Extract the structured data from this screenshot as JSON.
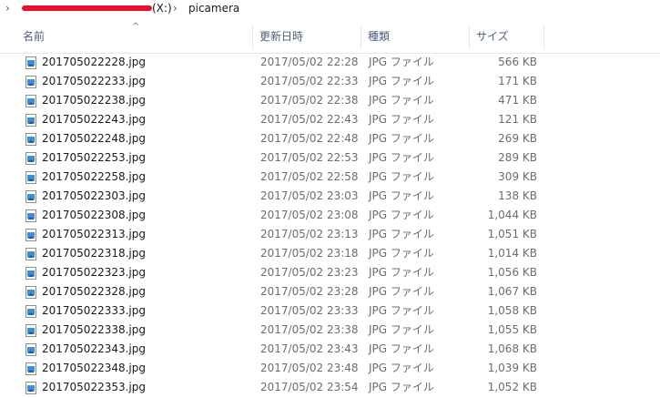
{
  "breadcrumb": {
    "drive": "(X:)",
    "separator": "›",
    "folder": "picamera"
  },
  "columns": {
    "name": "名前",
    "date": "更新日時",
    "type": "種類",
    "size": "サイズ"
  },
  "sort_indicator": "^",
  "files": [
    {
      "name": "201705022228.jpg",
      "date": "2017/05/02 22:28",
      "type": "JPG ファイル",
      "size": "566 KB"
    },
    {
      "name": "201705022233.jpg",
      "date": "2017/05/02 22:33",
      "type": "JPG ファイル",
      "size": "171 KB"
    },
    {
      "name": "201705022238.jpg",
      "date": "2017/05/02 22:38",
      "type": "JPG ファイル",
      "size": "471 KB"
    },
    {
      "name": "201705022243.jpg",
      "date": "2017/05/02 22:43",
      "type": "JPG ファイル",
      "size": "121 KB"
    },
    {
      "name": "201705022248.jpg",
      "date": "2017/05/02 22:48",
      "type": "JPG ファイル",
      "size": "269 KB"
    },
    {
      "name": "201705022253.jpg",
      "date": "2017/05/02 22:53",
      "type": "JPG ファイル",
      "size": "289 KB"
    },
    {
      "name": "201705022258.jpg",
      "date": "2017/05/02 22:58",
      "type": "JPG ファイル",
      "size": "309 KB"
    },
    {
      "name": "201705022303.jpg",
      "date": "2017/05/02 23:03",
      "type": "JPG ファイル",
      "size": "138 KB"
    },
    {
      "name": "201705022308.jpg",
      "date": "2017/05/02 23:08",
      "type": "JPG ファイル",
      "size": "1,044 KB"
    },
    {
      "name": "201705022313.jpg",
      "date": "2017/05/02 23:13",
      "type": "JPG ファイル",
      "size": "1,051 KB"
    },
    {
      "name": "201705022318.jpg",
      "date": "2017/05/02 23:18",
      "type": "JPG ファイル",
      "size": "1,014 KB"
    },
    {
      "name": "201705022323.jpg",
      "date": "2017/05/02 23:23",
      "type": "JPG ファイル",
      "size": "1,056 KB"
    },
    {
      "name": "201705022328.jpg",
      "date": "2017/05/02 23:28",
      "type": "JPG ファイル",
      "size": "1,067 KB"
    },
    {
      "name": "201705022333.jpg",
      "date": "2017/05/02 23:33",
      "type": "JPG ファイル",
      "size": "1,058 KB"
    },
    {
      "name": "201705022338.jpg",
      "date": "2017/05/02 23:38",
      "type": "JPG ファイル",
      "size": "1,055 KB"
    },
    {
      "name": "201705022343.jpg",
      "date": "2017/05/02 23:43",
      "type": "JPG ファイル",
      "size": "1,068 KB"
    },
    {
      "name": "201705022348.jpg",
      "date": "2017/05/02 23:48",
      "type": "JPG ファイル",
      "size": "1,039 KB"
    },
    {
      "name": "201705022353.jpg",
      "date": "2017/05/02 23:54",
      "type": "JPG ファイル",
      "size": "1,052 KB"
    }
  ],
  "colors": {
    "redaction": "#e8102a",
    "header_text": "#4c607a",
    "secondary_text": "#6d6d6d",
    "image_icon": "#3f8fd8"
  },
  "icons": {
    "file": "jpg-file-icon"
  }
}
